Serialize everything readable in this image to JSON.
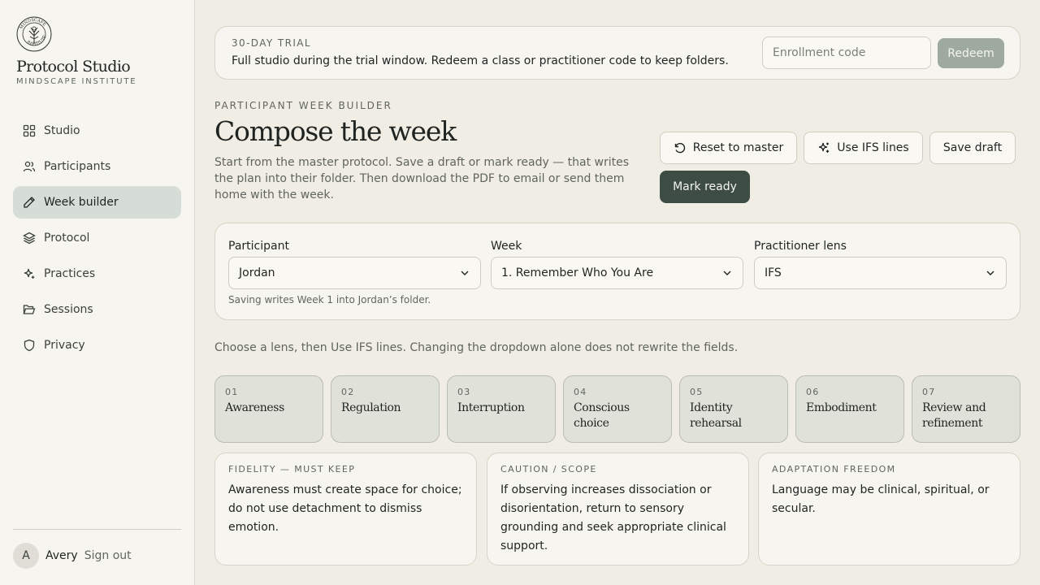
{
  "sidebar": {
    "logo_text": "MINDSCAPE INSTITUTE",
    "brand_title": "Protocol Studio",
    "brand_subtitle": "MINDSCAPE INSTITUTE",
    "items": [
      {
        "label": "Studio",
        "icon": "grid-icon"
      },
      {
        "label": "Participants",
        "icon": "users-icon"
      },
      {
        "label": "Week builder",
        "icon": "pencil-icon",
        "active": true
      },
      {
        "label": "Protocol",
        "icon": "layers-icon"
      },
      {
        "label": "Practices",
        "icon": "sparkles-icon"
      },
      {
        "label": "Sessions",
        "icon": "folder-open-icon"
      },
      {
        "label": "Privacy",
        "icon": "shield-icon"
      }
    ],
    "user": {
      "initial": "A",
      "name": "Avery",
      "signout_label": "Sign out"
    }
  },
  "banner": {
    "eyebrow": "30-DAY TRIAL",
    "text": "Full studio during the trial window. Redeem a class or practitioner code to keep folders.",
    "input_placeholder": "Enrollment code",
    "input_value": "",
    "redeem_label": "Redeem"
  },
  "header": {
    "eyebrow": "PARTICIPANT WEEK BUILDER",
    "title": "Compose the week",
    "description": "Start from the master protocol. Save a draft or mark ready — that writes the plan into their folder. Then download the PDF to email or send them home with the week.",
    "buttons": {
      "reset": "Reset to master",
      "ifs": "Use IFS lines",
      "save": "Save draft",
      "ready": "Mark ready"
    }
  },
  "selectors": {
    "participant": {
      "label": "Participant",
      "value": "Jordan"
    },
    "week": {
      "label": "Week",
      "value": "1. Remember Who You Are"
    },
    "lens": {
      "label": "Practitioner lens",
      "value": "IFS"
    },
    "note": "Saving writes Week 1 into Jordan’s folder."
  },
  "lens_hint": "Choose a lens, then Use IFS lines. Changing the dropdown alone does not rewrite the fields.",
  "steps": [
    {
      "num": "01",
      "name": "Awareness"
    },
    {
      "num": "02",
      "name": "Regulation"
    },
    {
      "num": "03",
      "name": "Interruption"
    },
    {
      "num": "04",
      "name": "Conscious choice"
    },
    {
      "num": "05",
      "name": "Identity rehearsal"
    },
    {
      "num": "06",
      "name": "Embodiment"
    },
    {
      "num": "07",
      "name": "Review and refinement"
    }
  ],
  "cards": [
    {
      "eyebrow": "FIDELITY — MUST KEEP",
      "text": "Awareness must create space for choice; do not use detachment to dismiss emotion."
    },
    {
      "eyebrow": "CAUTION / SCOPE",
      "text": "If observing increases dissociation or disorientation, return to sensory grounding and seek appropriate clinical support."
    },
    {
      "eyebrow": "ADAPTATION FREEDOM",
      "text": "Language may be clinical, spiritual, or secular."
    }
  ],
  "colors": {
    "background": "#f0ede4",
    "sidebar": "#f7f5ef",
    "accent_dark": "#3e4d44",
    "active_nav": "#d6ddd6",
    "redeem": "#9eaa9f"
  }
}
